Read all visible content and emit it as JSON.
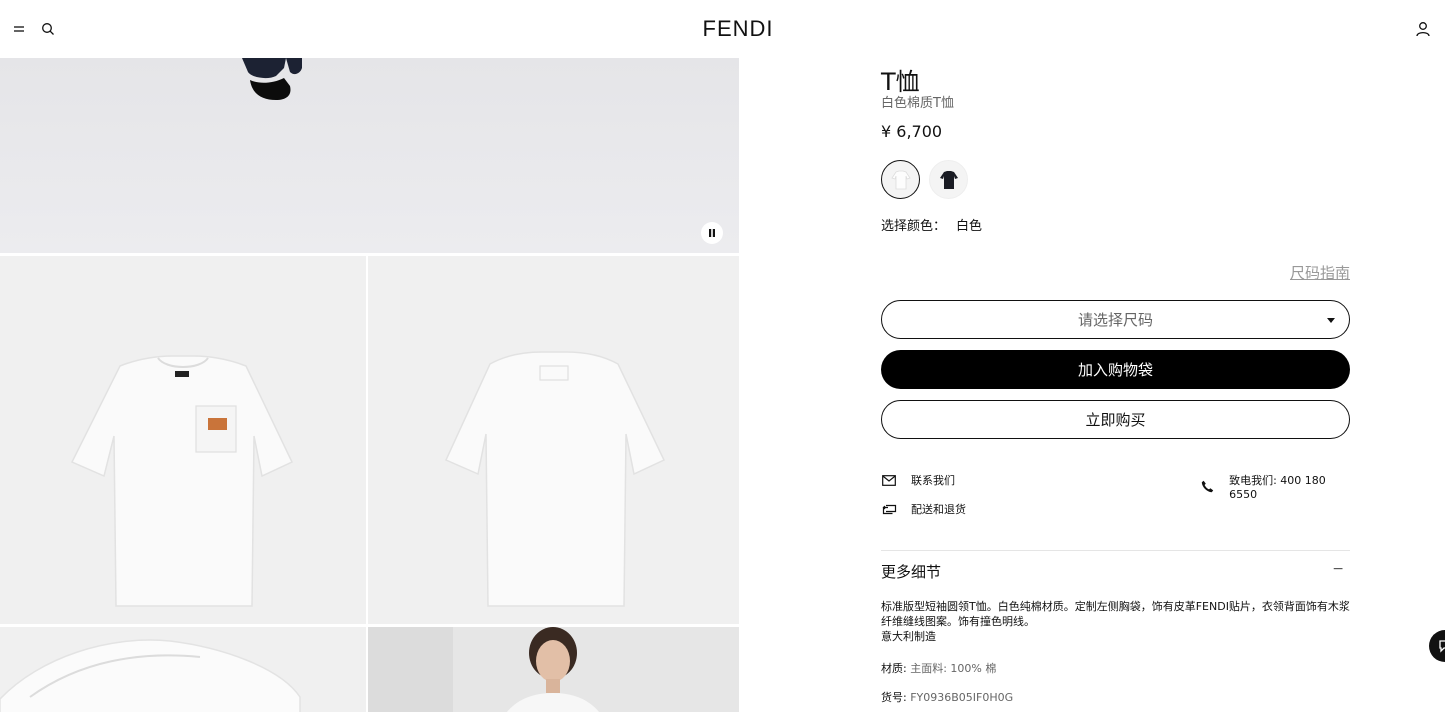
{
  "header": {
    "logo": "FENDI"
  },
  "product": {
    "title": "T恤",
    "subtitle": "白色棉质T恤",
    "price": "¥ 6,700",
    "color_label": "选择颜色：",
    "color_value": "白色",
    "size_guide": "尺码指南",
    "size_placeholder": "请选择尺码",
    "add_to_bag": "加入购物袋",
    "buy_now": "立即购买"
  },
  "services": {
    "contact": "联系我们",
    "call": "致电我们: 400 180 6550",
    "shipping": "配送和退货"
  },
  "details": {
    "title": "更多细节",
    "toggle": "−",
    "description_1": "标准版型短袖圆领T恤。白色纯棉材质。定制左侧胸袋，饰有皮革FENDI贴片，衣领背面饰有木浆",
    "description_2": "纤维缝线图案。饰有撞色明线。",
    "origin": "意大利制造",
    "material_label": "材质:",
    "material_value": "主面料: 100% 棉",
    "sku_label": "货号:",
    "sku_value": "FY0936B05IF0H0G"
  }
}
